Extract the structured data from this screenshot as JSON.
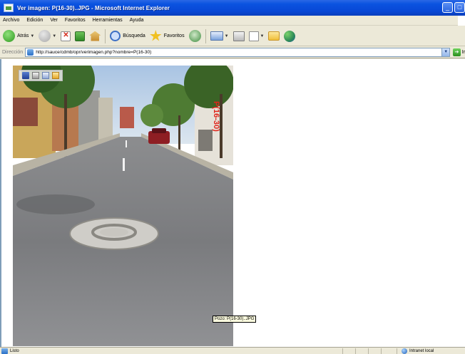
{
  "window": {
    "title": "Ver imagen: P(16-30)..JPG - Microsoft Internet Explorer",
    "controls": {
      "minimize": "_",
      "maximize": "□"
    }
  },
  "menu": [
    "Archivo",
    "Edición",
    "Ver",
    "Favoritos",
    "Herramientas",
    "Ayuda"
  ],
  "toolbar": {
    "back_label": "Atrás",
    "search_label": "Búsqueda",
    "favorites_label": "Favoritos"
  },
  "address": {
    "label": "Dirección",
    "url": "http://sauce/cdmb/opr/verimagen.php?nombre=P(16-30)",
    "go_label": "Ir"
  },
  "content": {
    "tooltip": "Pozo: P(16-30)..JPG",
    "photo_overlay": "P(16-30)"
  },
  "status": {
    "text": "Listo",
    "zone": "Intranet local"
  }
}
